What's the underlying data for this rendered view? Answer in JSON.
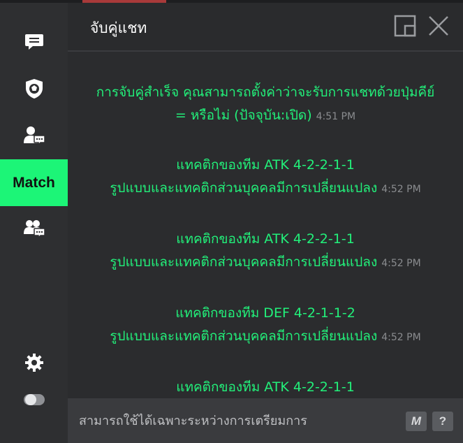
{
  "window": {
    "title": "จับคู่แชท"
  },
  "sidebar": {
    "items": [
      {
        "icon": "chat-bubble-icon"
      },
      {
        "icon": "shield-ball-icon"
      },
      {
        "icon": "user-chat-icon"
      },
      {
        "label": "Match"
      },
      {
        "icon": "group-chat-icon"
      }
    ],
    "bottom": [
      {
        "icon": "gear-icon"
      },
      {
        "icon": "toggle-icon"
      }
    ]
  },
  "messages": [
    {
      "lines": [
        "การจับคู่สำเร็จ คุณสามารถตั้งค่าว่าจะรับการแชทด้วยปุ่มคีย์",
        "= หรือไม่ (ปัจจุบัน:เปิด)"
      ],
      "time": "4:51 PM"
    },
    {
      "lines": [
        "แทคติกของทีม ATK 4-2-2-1-1",
        "รูปแบบและแทคติกส่วนบุคคลมีการเปลี่ยนแปลง"
      ],
      "time": "4:52 PM"
    },
    {
      "lines": [
        "แทคติกของทีม ATK 4-2-2-1-1",
        "รูปแบบและแทคติกส่วนบุคคลมีการเปลี่ยนแปลง"
      ],
      "time": "4:52 PM"
    },
    {
      "lines": [
        "แทคติกของทีม DEF 4-2-1-1-2",
        "รูปแบบและแทคติกส่วนบุคคลมีการเปลี่ยนแปลง"
      ],
      "time": "4:52 PM"
    },
    {
      "lines": [
        "แทคติกของทีม ATK 4-2-2-1-1"
      ],
      "time": ""
    }
  ],
  "input": {
    "placeholder": "สามารถใช้ได้เฉพาะระหว่างการเตรียมการ",
    "macro_label": "M",
    "help_label": "?"
  },
  "colors": {
    "accent": "#1cf577",
    "message_text": "#22f07a",
    "timestamp": "#8a8c8f"
  }
}
